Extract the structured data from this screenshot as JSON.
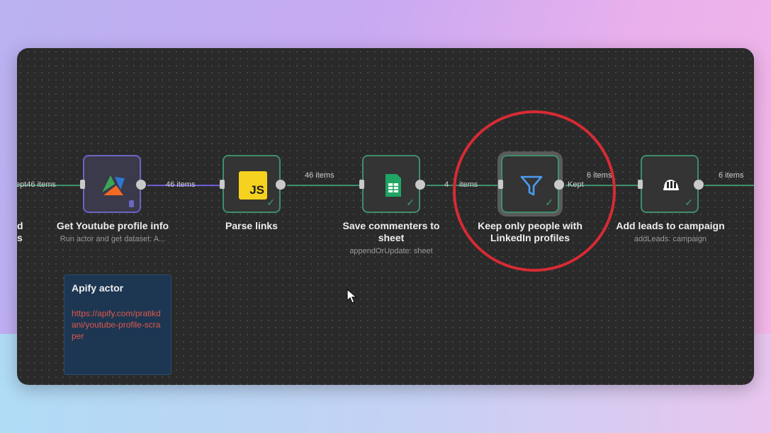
{
  "canvas": {
    "nodes": [
      {
        "id": "left-partial",
        "title_lines": [
          "d",
          "s"
        ]
      },
      {
        "id": "get-youtube",
        "title": "Get Youtube profile info",
        "subtitle": "Run actor and get dataset: A...",
        "icon": "apify-icon"
      },
      {
        "id": "parse-links",
        "title": "Parse links",
        "icon": "javascript-icon",
        "icon_text": "JS"
      },
      {
        "id": "save-commenters",
        "title_lines": [
          "Save commenters to",
          "sheet"
        ],
        "subtitle": "appendOrUpdate: sheet",
        "icon": "google-sheets-icon"
      },
      {
        "id": "keep-only",
        "title_lines": [
          "Keep only people with",
          "LinkedIn profiles"
        ],
        "icon": "filter-icon",
        "output_label": "Kept"
      },
      {
        "id": "add-leads",
        "title": "Add leads to campaign",
        "subtitle": "addLeads: campaign",
        "icon": "lemlist-icon"
      }
    ],
    "edges": [
      {
        "label": "ept46 items"
      },
      {
        "label": "46 items"
      },
      {
        "label": "46 items"
      },
      {
        "label": "4",
        "label_b": "items"
      },
      {
        "label": "6 items"
      },
      {
        "label": "6 items"
      }
    ],
    "sticky": {
      "title": "Apify actor",
      "link": "https://apify.com/pratikdani/youtube-profile-scraper"
    }
  },
  "colors": {
    "connection": "#3f8e6c",
    "highlight_circle": "#d62b34",
    "sticky_bg": "#1d3652",
    "link": "#e0584a"
  }
}
